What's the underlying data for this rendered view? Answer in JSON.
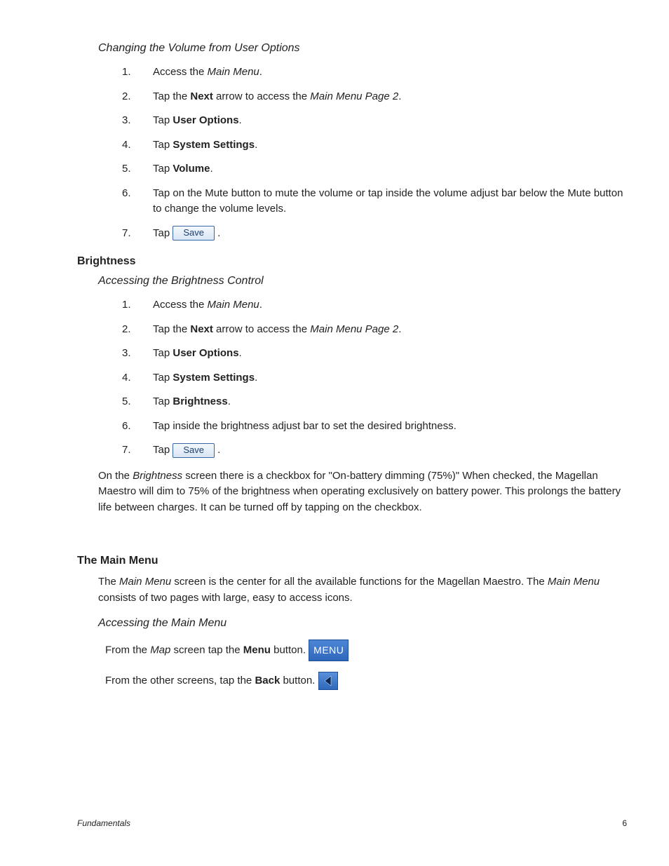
{
  "section1": {
    "heading": "Changing the Volume from User Options",
    "steps": [
      {
        "n": "1.",
        "pre": "Access the ",
        "italic": "Main Menu",
        "post": "."
      },
      {
        "n": "2.",
        "pre": "Tap the ",
        "bold": "Next",
        "mid": " arrow to access the ",
        "italic": "Main Menu Page 2",
        "post": "."
      },
      {
        "n": "3.",
        "pre": "Tap ",
        "bold": "User Options",
        "post": "."
      },
      {
        "n": "4.",
        "pre": "Tap ",
        "bold": "System Settings",
        "post": "."
      },
      {
        "n": "5.",
        "pre": "Tap ",
        "bold": "Volume",
        "post": "."
      },
      {
        "n": "6.",
        "plain": "Tap on the Mute button to mute the volume or tap inside the volume adjust bar below the Mute button to change the volume levels."
      },
      {
        "n": "7.",
        "pre": "Tap ",
        "button": "Save",
        "post": " ."
      }
    ]
  },
  "brightness": {
    "heading": "Brightness",
    "sub": "Accessing the Brightness Control",
    "steps": [
      {
        "n": "1.",
        "pre": "Access the ",
        "italic": "Main Menu",
        "post": "."
      },
      {
        "n": "2.",
        "pre": "Tap the ",
        "bold": "Next",
        "mid": " arrow to access the ",
        "italic": "Main Menu Page 2",
        "post": "."
      },
      {
        "n": "3.",
        "pre": "Tap ",
        "bold": "User Options",
        "post": "."
      },
      {
        "n": "4.",
        "pre": "Tap ",
        "bold": "System Settings",
        "post": "."
      },
      {
        "n": "5.",
        "pre": "Tap ",
        "bold": "Brightness",
        "post": "."
      },
      {
        "n": "6.",
        "plain": "Tap inside the brightness adjust bar to set the desired brightness."
      },
      {
        "n": "7.",
        "pre": "Tap ",
        "button": "Save",
        "post": " ."
      }
    ],
    "note_pre": "On the ",
    "note_italic": "Brightness",
    "note_post": " screen there is a checkbox for \"On-battery dimming (75%)\"  When checked, the Magellan Maestro will dim to 75% of the brightness when operating exclusively on battery power.  This prolongs the battery life between charges.  It can be turned off by tapping on the checkbox."
  },
  "mainmenu": {
    "heading": "The Main Menu",
    "para_pre": "The ",
    "para_i1": "Main Menu",
    "para_mid": " screen is the center for all the available functions for the Magellan Maestro.  The ",
    "para_i2": "Main Menu",
    "para_post": " consists of two pages with large, easy to access icons.",
    "sub": "Accessing the Main Menu",
    "line1_pre": "From the ",
    "line1_italic": "Map",
    "line1_mid": " screen tap the ",
    "line1_bold": "Menu",
    "line1_post": " button. ",
    "menu_button": "MENU",
    "line2_pre": "From the other screens, tap the ",
    "line2_bold": "Back",
    "line2_post": " button.  "
  },
  "footer": {
    "left": "Fundamentals",
    "right": "6"
  }
}
